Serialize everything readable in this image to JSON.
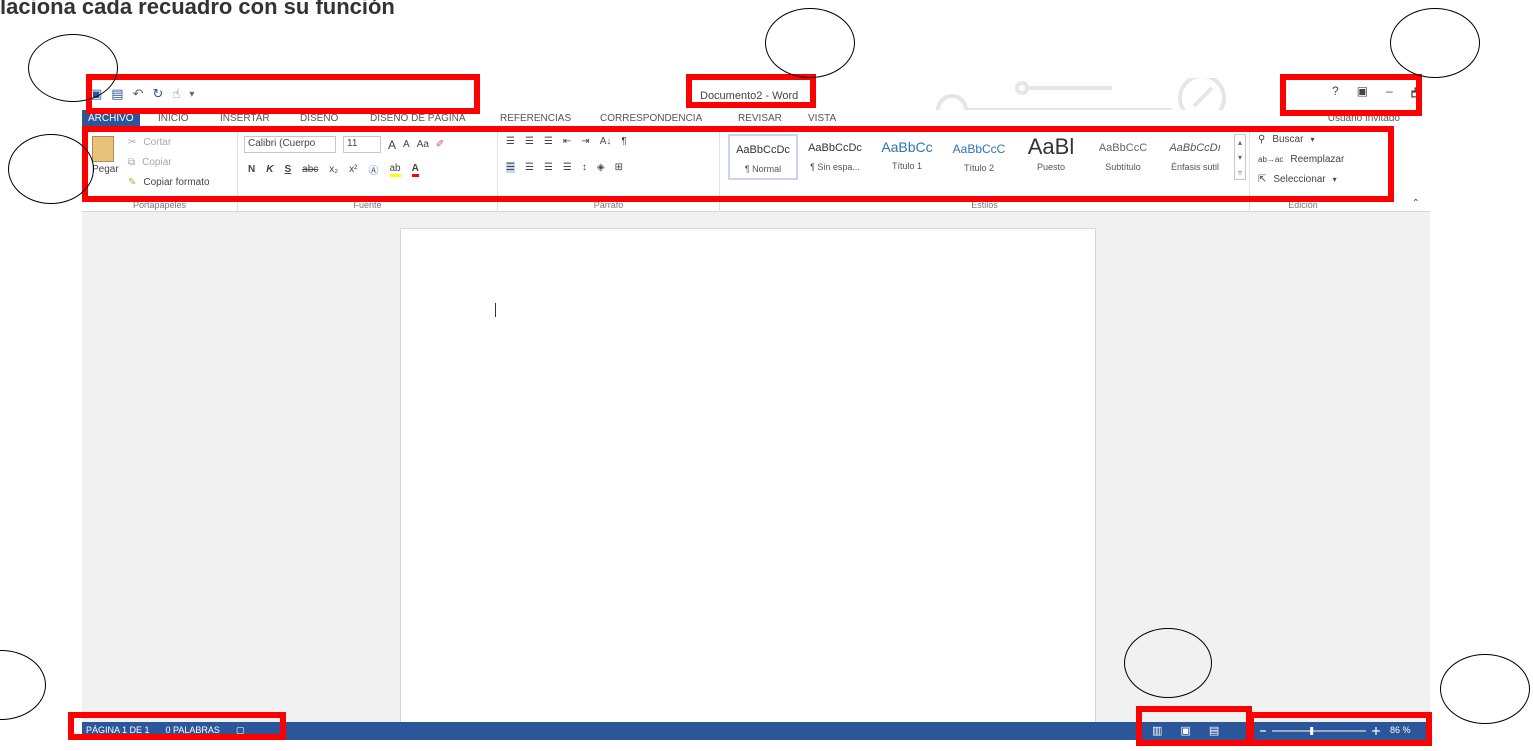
{
  "heading": "laciona cada recuadro con su función",
  "window": {
    "title": "Documento2 - Word",
    "quick_access": {
      "save_icon": "save-icon",
      "undo_icon": "undo-icon",
      "redo_icon": "redo-icon",
      "touch_icon": "touch-mode-icon",
      "customize_icon": "customize-qat-icon"
    },
    "controls": {
      "help": "?",
      "ribbon_options": "▣",
      "minimize": "–",
      "restore": "🗗"
    },
    "user": "Usuario Invitado"
  },
  "tabs": [
    "ARCHIVO",
    "INICIO",
    "INSERTAR",
    "DISEÑO",
    "DISEÑO DE PÁGINA",
    "REFERENCIAS",
    "CORRESPONDENCIA",
    "REVISAR",
    "VISTA"
  ],
  "ribbon": {
    "clipboard": {
      "label": "Portapapeles",
      "paste": "Pegar",
      "cut": "Cortar",
      "copy": "Copiar",
      "format_painter": "Copiar formato"
    },
    "font": {
      "label": "Fuente",
      "font_name": "Calibri (Cuerpo",
      "font_size": "11",
      "grow": "A",
      "shrink": "A",
      "case": "Aa",
      "bold": "N",
      "italic": "K",
      "underline": "S",
      "strike": "abc",
      "subscript": "x₂",
      "superscript": "x²"
    },
    "paragraph": {
      "label": "Párrafo",
      "sort": "A↓",
      "pilcrow": "¶"
    },
    "styles": {
      "label": "Estilos",
      "items": [
        {
          "sample": "AaBbCcDc",
          "name": "¶ Normal"
        },
        {
          "sample": "AaBbCcDc",
          "name": "¶ Sin espa..."
        },
        {
          "sample": "AaBbCc",
          "name": "Título 1"
        },
        {
          "sample": "AaBbCcC",
          "name": "Título 2"
        },
        {
          "sample": "AaBl",
          "name": "Puesto"
        },
        {
          "sample": "AaBbCcC",
          "name": "Subtítulo"
        },
        {
          "sample": "AaBbCcDı",
          "name": "Énfasis sutil"
        }
      ]
    },
    "editing": {
      "label": "Edición",
      "find": "Buscar",
      "replace": "Reemplazar",
      "select": "Seleccionar"
    }
  },
  "status": {
    "page": "PÁGINA 1 DE 1",
    "words": "0 PALABRAS",
    "zoom_value": 86,
    "zoom": "86 %"
  },
  "colors": {
    "accent": "#2b579a",
    "highlight": "#ff0000"
  }
}
